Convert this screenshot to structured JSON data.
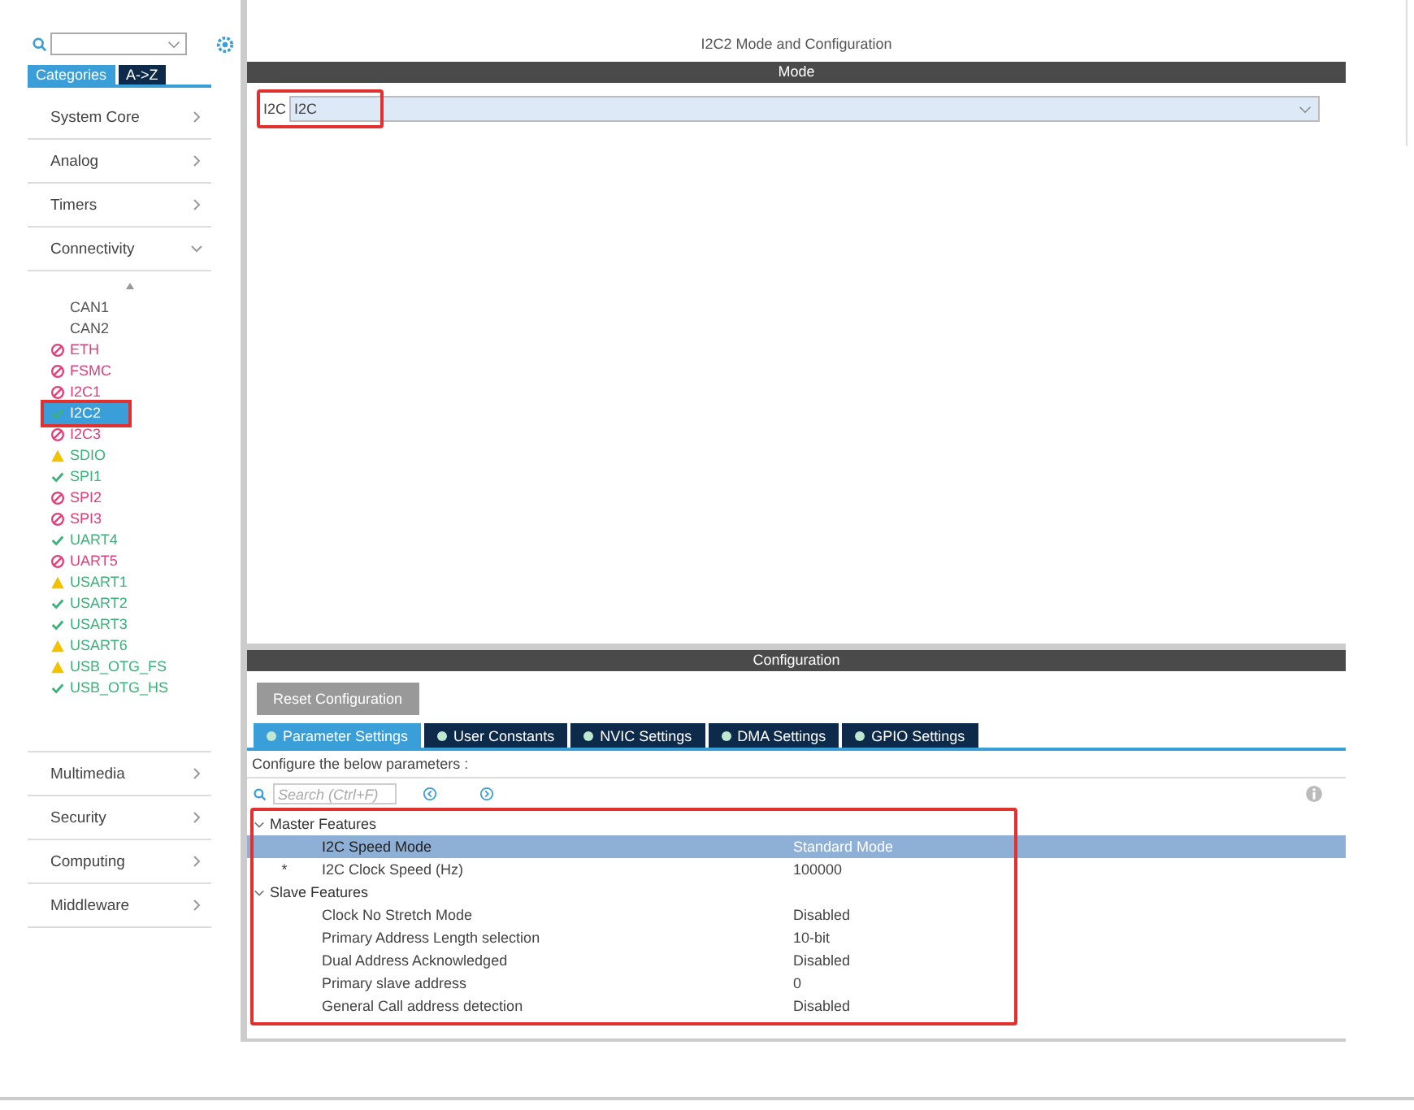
{
  "sidebar": {
    "tabs": [
      {
        "label": "Categories",
        "selected": true
      },
      {
        "label": "A->Z",
        "selected": false
      }
    ],
    "categories": [
      {
        "label": "System Core",
        "expanded": false
      },
      {
        "label": "Analog",
        "expanded": false
      },
      {
        "label": "Timers",
        "expanded": false
      },
      {
        "label": "Connectivity",
        "expanded": true,
        "children": [
          {
            "label": "CAN1",
            "kind": "none",
            "selected": false
          },
          {
            "label": "CAN2",
            "kind": "none",
            "selected": false
          },
          {
            "label": "ETH",
            "kind": "disabled",
            "selected": false
          },
          {
            "label": "FSMC",
            "kind": "disabled",
            "selected": false
          },
          {
            "label": "I2C1",
            "kind": "disabled",
            "selected": false
          },
          {
            "label": "I2C2",
            "kind": "ok",
            "selected": true
          },
          {
            "label": "I2C3",
            "kind": "disabled",
            "selected": false
          },
          {
            "label": "SDIO",
            "kind": "warning",
            "selected": false
          },
          {
            "label": "SPI1",
            "kind": "ok",
            "selected": false
          },
          {
            "label": "SPI2",
            "kind": "disabled",
            "selected": false
          },
          {
            "label": "SPI3",
            "kind": "disabled",
            "selected": false
          },
          {
            "label": "UART4",
            "kind": "ok",
            "selected": false
          },
          {
            "label": "UART5",
            "kind": "disabled",
            "selected": false
          },
          {
            "label": "USART1",
            "kind": "warning",
            "selected": false
          },
          {
            "label": "USART2",
            "kind": "ok",
            "selected": false
          },
          {
            "label": "USART3",
            "kind": "ok",
            "selected": false
          },
          {
            "label": "USART6",
            "kind": "warning",
            "selected": false
          },
          {
            "label": "USB_OTG_FS",
            "kind": "warning",
            "selected": false
          },
          {
            "label": "USB_OTG_HS",
            "kind": "ok",
            "selected": false
          }
        ]
      },
      {
        "label": "Multimedia",
        "expanded": false
      },
      {
        "label": "Security",
        "expanded": false
      },
      {
        "label": "Computing",
        "expanded": false
      },
      {
        "label": "Middleware",
        "expanded": false
      }
    ]
  },
  "main": {
    "title": "I2C2 Mode and Configuration",
    "mode_header": "Mode",
    "mode_field": {
      "label": "I2C",
      "value": "I2C"
    },
    "configuration_header": "Configuration",
    "reset_button": "Reset Configuration",
    "tabs": [
      {
        "label": "Parameter Settings",
        "selected": true
      },
      {
        "label": "User Constants",
        "selected": false
      },
      {
        "label": "NVIC Settings",
        "selected": false
      },
      {
        "label": "DMA Settings",
        "selected": false
      },
      {
        "label": "GPIO Settings",
        "selected": false
      }
    ],
    "hint": "Configure the below parameters :",
    "search": {
      "placeholder": "Search (Ctrl+F)"
    },
    "groups": [
      {
        "label": "Master Features",
        "expanded": true,
        "rows": [
          {
            "marker": "",
            "name": "I2C Speed Mode",
            "value": "Standard Mode",
            "selected": true
          },
          {
            "marker": "*",
            "name": "I2C Clock Speed (Hz)",
            "value": "100000",
            "selected": false
          }
        ]
      },
      {
        "label": "Slave Features",
        "expanded": true,
        "rows": [
          {
            "marker": "",
            "name": "Clock No Stretch Mode",
            "value": "Disabled",
            "selected": false
          },
          {
            "marker": "",
            "name": "Primary Address Length selection",
            "value": "10-bit",
            "selected": false
          },
          {
            "marker": "",
            "name": "Dual Address Acknowledged",
            "value": "Disabled",
            "selected": false
          },
          {
            "marker": "",
            "name": "Primary slave address",
            "value": "0",
            "selected": false
          },
          {
            "marker": "",
            "name": "General Call address detection",
            "value": "Disabled",
            "selected": false
          }
        ]
      }
    ]
  }
}
